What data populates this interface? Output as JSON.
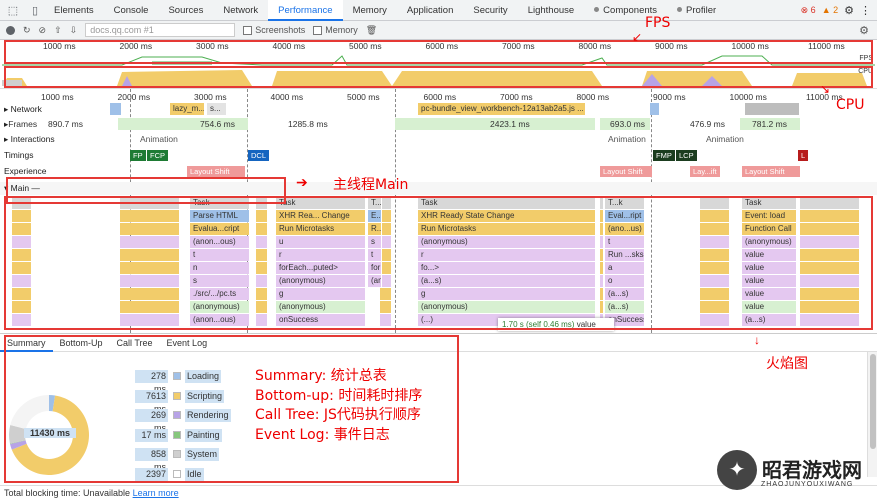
{
  "tabs": [
    {
      "label": "Elements"
    },
    {
      "label": "Console"
    },
    {
      "label": "Sources"
    },
    {
      "label": "Network"
    },
    {
      "label": "Performance",
      "active": true
    },
    {
      "label": "Memory"
    },
    {
      "label": "Application"
    },
    {
      "label": "Security"
    },
    {
      "label": "Lighthouse"
    },
    {
      "label": "Components",
      "dot": true
    },
    {
      "label": "Profiler",
      "dot": true
    }
  ],
  "tabbar": {
    "errors": "6",
    "warnings": "2"
  },
  "toolbar": {
    "url": "docs.qq.com #1",
    "screenshots": "Screenshots",
    "memory": "Memory"
  },
  "ruler": [
    "1000 ms",
    "2000 ms",
    "3000 ms",
    "4000 ms",
    "5000 ms",
    "6000 ms",
    "7000 ms",
    "8000 ms",
    "9000 ms",
    "10000 ms",
    "11000 ms"
  ],
  "overview_labels": {
    "fps": "FPS",
    "cpu": "CPU"
  },
  "tracks": {
    "network": "Network",
    "frames": "Frames",
    "interactions": "Interactions",
    "timings": "Timings",
    "experience": "Experience",
    "main": "Main —",
    "frame_times": [
      "890.7 ms",
      "754.6 ms",
      "1285.8 ms",
      "2423.1 ms",
      "693.0 ms",
      "476.9 ms",
      "781.2 ms"
    ],
    "network_items": [
      "lazy_m...",
      "s...",
      "pc-bundle_view_workbench-12a13ab2a5.js ..."
    ],
    "animation": "Animation",
    "timing_markers": [
      "FP",
      "FCP",
      "DCL",
      "FMP",
      "LCP",
      "L"
    ],
    "layout_shift": [
      "Layout Shift",
      "Layout Shift",
      "Lay...ift",
      "Layout Shift"
    ]
  },
  "flame": {
    "task_labels": [
      "Task",
      "Task",
      "T...",
      "Task",
      "T...k",
      "Task"
    ],
    "row2": [
      "Parse HTML",
      "XHR Rea... Change",
      "E...",
      "XHR Ready State Change",
      "Eval...ript",
      "Event: load"
    ],
    "row3": [
      "Evalua...cript",
      "Run Microtasks",
      "R...",
      "Run Microtasks",
      "(ano...us)",
      "Function Call"
    ],
    "row4": [
      "(anon...ous)",
      "u",
      "s",
      "(anonymous)",
      "t",
      "(anonymous)"
    ],
    "row5": [
      "t",
      "r",
      "t",
      "r",
      "Run ...sks",
      "value"
    ],
    "row6": [
      "n",
      "forEach...puted>",
      "forEach.e.<computed>",
      "fo...>",
      "a",
      "value"
    ],
    "row7": [
      "s",
      "(anonymous)",
      "(anonymous)",
      "(a...s)",
      "o",
      "value"
    ],
    "row8": [
      "./src/.../pc.ts",
      "g",
      "g",
      "(a...s)",
      "value"
    ],
    "row9": [
      "(anonymous)",
      "(anonymous)",
      "(anonymous)",
      "(a...s)",
      "value"
    ],
    "row10": [
      "(anon...ous)",
      "onSuccess",
      "(...)",
      "onSuccess",
      "(a...s)"
    ],
    "tooltip_time": "1.70 s (self 0.46 ms)",
    "tooltip_name": "value"
  },
  "bottom": {
    "tabs": [
      "Summary",
      "Bottom-Up",
      "Call Tree",
      "Event Log"
    ],
    "total": "11430 ms",
    "legend": [
      {
        "value": "278 ms",
        "name": "Loading",
        "color": "#9fc0e8"
      },
      {
        "value": "7613 ms",
        "name": "Scripting",
        "color": "#f2cc6a"
      },
      {
        "value": "269 ms",
        "name": "Rendering",
        "color": "#b7a3e6"
      },
      {
        "value": "17 ms",
        "name": "Painting",
        "color": "#86c77c"
      },
      {
        "value": "858 ms",
        "name": "System",
        "color": "#cfcfcf"
      },
      {
        "value": "2397 ms",
        "name": "Idle",
        "color": "#ffffff"
      }
    ],
    "notes": [
      "Summary: 统计总表",
      "Bottom-up: 时间耗时排序",
      "Call Tree: JS代码执行顺序",
      "Event Log: 事件日志"
    ]
  },
  "status": {
    "text": "Total blocking time: Unavailable",
    "link": "Learn more"
  },
  "annotations": {
    "fps": "FPS",
    "cpu": "CPU",
    "main": "主线程Main",
    "flame": "火焰图"
  },
  "watermark": {
    "title": "昭君游戏网",
    "sub": "ZHAOJUNYOUXIWANG"
  }
}
